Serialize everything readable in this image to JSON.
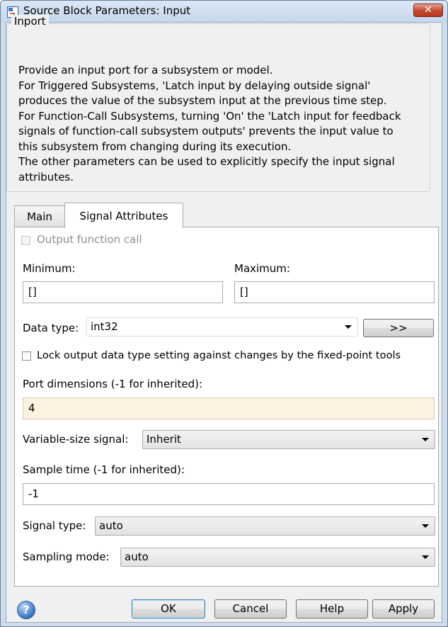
{
  "window": {
    "title": "Source Block Parameters: Input",
    "close_symbol": "✕"
  },
  "group": {
    "title": "Inport",
    "description_lines": [
      "Provide an input port for a subsystem or model.",
      "For Triggered Subsystems, 'Latch input by delaying outside signal'",
      "produces the value of the subsystem input at the previous time step.",
      "For Function-Call Subsystems, turning 'On' the 'Latch input for feedback",
      "signals of function-call subsystem outputs' prevents the input value to",
      "this subsystem from changing during its execution.",
      "The other parameters can be used to explicitly specify the input signal",
      "attributes."
    ]
  },
  "tabs": [
    {
      "label": "Main",
      "selected": false
    },
    {
      "label": "Signal Attributes",
      "selected": true
    }
  ],
  "signal_attributes": {
    "output_function_call": {
      "label": "Output function call",
      "checked": false,
      "enabled": false
    },
    "minimum": {
      "label": "Minimum:",
      "value": "[]"
    },
    "maximum": {
      "label": "Maximum:",
      "value": "[]"
    },
    "data_type": {
      "label": "Data type:",
      "value": "int32",
      "assistant_button": ">>"
    },
    "lock_output": {
      "label": "Lock output data type setting against changes by the fixed-point tools",
      "checked": false
    },
    "port_dimensions": {
      "label": "Port dimensions (-1 for inherited):",
      "value": "4"
    },
    "variable_size": {
      "label": "Variable-size signal:",
      "value": "Inherit"
    },
    "sample_time": {
      "label": "Sample time (-1 for inherited):",
      "value": "-1"
    },
    "signal_type": {
      "label": "Signal type:",
      "value": "auto"
    },
    "sampling_mode": {
      "label": "Sampling mode:",
      "value": "auto"
    }
  },
  "buttons": {
    "help_icon": "?",
    "ok": "OK",
    "cancel": "Cancel",
    "help": "Help",
    "apply": "Apply"
  },
  "icons": {
    "app": "simulink-block-icon",
    "close": "close-icon",
    "help": "help-icon",
    "dropdown": "chevron-down-icon"
  },
  "colors": {
    "title_bar": "#c6d7ec",
    "close_button": "#c74d34",
    "focused_field": "#fdf2e2",
    "default_button_border": "#3c7fb1"
  }
}
